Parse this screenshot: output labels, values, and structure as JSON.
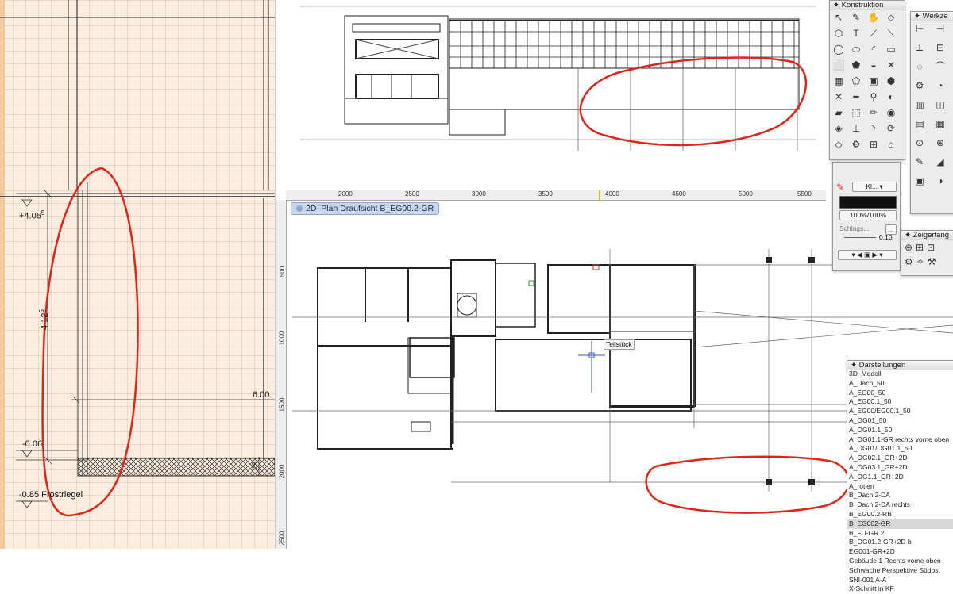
{
  "left_section": {
    "labels": {
      "level_top": "+4.06",
      "level_top_sup": "5",
      "height": "4.12",
      "height_sup": "5",
      "width": "6.00",
      "level_mid": "-0.06",
      "small": "25",
      "level_bottom": "-0.85 Frostriegel"
    }
  },
  "plan": {
    "title": "2D–Plan Draufsicht  B_EG00.2-GR",
    "ruler_top": [
      "2000",
      "2500",
      "3000",
      "3500",
      "4000",
      "4500",
      "5000",
      "5500"
    ],
    "ruler_left": [
      "500",
      "1000",
      "1500",
      "2000",
      "2500"
    ],
    "tooltip": "Teilstück"
  },
  "palettes": {
    "konstruktion": {
      "title": "Konstruktion"
    },
    "werkzeuge": {
      "title": "Werkze"
    },
    "attributes": {
      "pen_label": "Kl...",
      "opacity": "100%/100%",
      "schlag": "Schlags...",
      "line_value": "0.10",
      "dots": "..."
    },
    "zeigerfang": {
      "title": "Zeigerfang"
    },
    "darstellungen": {
      "title": "Darstellungen",
      "items": [
        "3D_Modell",
        "A_Dach_50",
        "A_EG00_50",
        "A_EG00.1_50",
        "A_EG00/EG00.1_50",
        "A_OG01_50",
        "A_OG01.1_50",
        "A_OG01.1-GR rechts vorne oben",
        "A_OG01/OG01.1_50",
        "A_OG02.1_GR+2D",
        "A_OG03.1_GR+2D",
        "A_OG1.1_GR+2D",
        "A_rotiert",
        "B_Dach.2-DA",
        "B_Dach.2-DA rechts",
        "B_EG00.2-RB",
        "B_EG002-GR",
        "B_FU-GR.2",
        "B_OG01.2-GR+2D b",
        "EG001-GR+2D",
        "Gebäude 1 Rechts vorne oben",
        "Schwache Perspektive Südost",
        "SNI-001 A-A",
        "X-Schnitt in KF"
      ],
      "selected_index": 16
    }
  },
  "colors": {
    "annotation_red": "#e2231a",
    "left_bg": "#fbeee0",
    "title_bar": "#c9d6ef"
  }
}
